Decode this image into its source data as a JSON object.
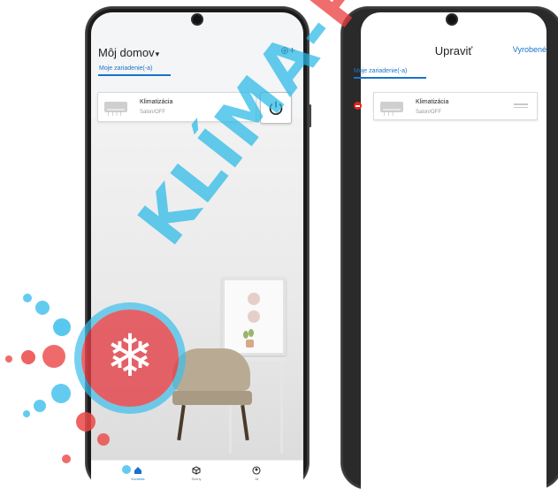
{
  "left_screen": {
    "home_title": "Môj domov",
    "title_chevron": "▾",
    "add_icon": "⊕+",
    "tab_label": "Moje zariadenie(-a)",
    "device": {
      "name": "Klimatizácia",
      "status": "Salon/OFF",
      "vents": "| | | |"
    },
    "bottom_nav": [
      {
        "label": "Kontrola",
        "icon": "home-icon",
        "active": true
      },
      {
        "label": "Scény",
        "icon": "cube-icon",
        "active": false
      },
      {
        "label": "Ja",
        "icon": "user-icon",
        "active": false
      }
    ]
  },
  "right_screen": {
    "title": "Upraviť",
    "done_label": "Vyrobené",
    "tab_label": "Moje zariadenie(-a)",
    "device": {
      "name": "Klimatizácia",
      "status": "Salon/OFF",
      "vents": "| | |"
    }
  },
  "watermark": {
    "text_blue": "KLÍMA-",
    "text_red": "PRE",
    "logo_icon": "❄"
  },
  "colors": {
    "accent": "#1a73c9",
    "remove": "#e2231a"
  }
}
